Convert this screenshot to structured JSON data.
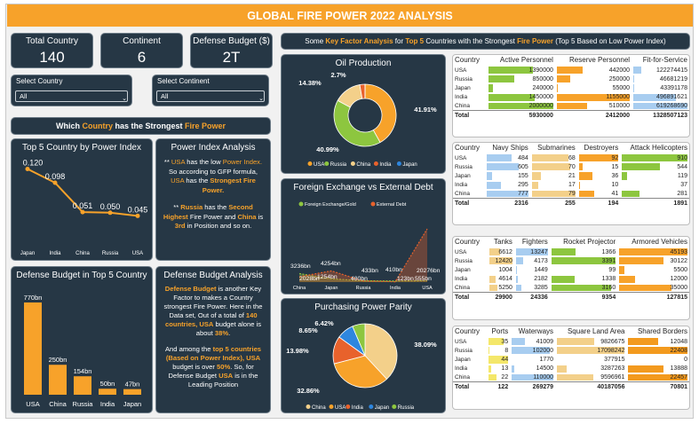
{
  "title": "GLOBAL FIRE POWER 2022 ANALYSIS",
  "kpis": [
    {
      "label": "Total Country",
      "value": "140"
    },
    {
      "label": "Continent",
      "value": "6"
    },
    {
      "label": "Defense Budget ($)",
      "value": "2T"
    }
  ],
  "slicers": {
    "country": {
      "label": "Select Country",
      "value": "All"
    },
    "continent": {
      "label": "Select Continent",
      "value": "All"
    }
  },
  "banner_left": {
    "pre": "Which ",
    "hl": "Country",
    "mid": " has the Strongest ",
    "hl2": "Fire Power"
  },
  "banner_right": {
    "p1": "Some ",
    "h1": "Key Factor Analysis",
    "p2": " for ",
    "h2": "Top 5",
    "p3": " Countries with the Strongest ",
    "h3": "Fire Power",
    "p4": " (Top 5 Based on Low Power Index)"
  },
  "power_index_title": "Top 5 Country by Power Index",
  "power_analysis": {
    "title": "Power Index Analysis",
    "p1a": "** ",
    "p1b": "USA",
    "p1c": " has the low ",
    "p1d": "Power Index.",
    "p1e": " So according to GFP formula, ",
    "p1f": "USA",
    "p1g": " has the ",
    "p1h": "Strongest Fire Power.",
    "p2a": "** ",
    "p2b": "Russia",
    "p2c": " has the ",
    "p2d": "Second Highest",
    "p2e": " Fire Power and ",
    "p2f": "China",
    "p2g": " is ",
    "p2h": "3rd",
    "p2i": " in Position and so on."
  },
  "defense_chart_title": "Defense Budget in Top 5 Country",
  "defense_analysis": {
    "title": "Defense Budget Analysis",
    "p1a": "Defense Budget",
    "p1b": " is another Key Factor to makes a Country strongest Fire Power. Here in the Data set, Out of a total of ",
    "p1c": "140 countries, USA",
    "p1d": " budget alone is about ",
    "p1e": "38%",
    "p1f": ".",
    "p2a": "And among the ",
    "p2b": "top 5 countries (Based on Power Index), USA",
    "p2c": " budget is over ",
    "p2d": "50%",
    "p2e": ". So, for Defense Budget ",
    "p2f": "USA",
    "p2g": " is in the Leading Position"
  },
  "oil_title": "Oil Production",
  "fx_title": "Foreign Exchange vs External Debt",
  "ppp_title": "Purchasing Power Parity",
  "colors": {
    "orange": "#f7a22a",
    "green": "#8dc63f",
    "beige": "#f3d08a",
    "red": "#e8622c",
    "blue": "#2e86de",
    "lightblue": "#a8cdf0",
    "yellow": "#f4e76a",
    "darkorange": "#f39a1e"
  },
  "chart_data": [
    {
      "type": "line",
      "title": "Top 5 Country by Power Index",
      "categories": [
        "Japan",
        "India",
        "China",
        "Russia",
        "USA"
      ],
      "values": [
        0.12,
        0.098,
        0.051,
        0.05,
        0.045
      ],
      "labels": [
        "0.120",
        "0.098",
        "0.051",
        "0.050",
        "0.045"
      ]
    },
    {
      "type": "bar",
      "title": "Defense Budget in Top 5 Country",
      "categories": [
        "USA",
        "China",
        "Russia",
        "India",
        "Japan"
      ],
      "values": [
        770,
        250,
        154,
        50,
        47
      ],
      "labels": [
        "770bn",
        "250bn",
        "154bn",
        "50bn",
        "47bn"
      ]
    },
    {
      "type": "pie",
      "title": "Oil Production",
      "legend": [
        "USA",
        "Russia",
        "China",
        "India",
        "Japan"
      ],
      "values": [
        41.91,
        40.99,
        14.38,
        2.7,
        0.02
      ],
      "labels": [
        "41.91%",
        "40.99%",
        "14.38%",
        "2.7%",
        ""
      ]
    },
    {
      "type": "line",
      "title": "Foreign Exchange vs External Debt",
      "categories": [
        "China",
        "Japan",
        "Russia",
        "India",
        "USA"
      ],
      "series": [
        {
          "name": "Foreign Exchange/Gold",
          "values": [
            3236,
            1254,
            480,
            410,
            555
          ],
          "labels": [
            "3236bn",
            "1254bn",
            "480bn",
            "410bn",
            "555bn"
          ]
        },
        {
          "name": "External Debt",
          "values": [
            2028,
            4254,
            433,
            123,
            20276
          ],
          "labels": [
            "2028bn",
            "4254bn",
            "433bn",
            "123bn",
            "20276bn"
          ]
        }
      ]
    },
    {
      "type": "pie",
      "title": "Purchasing Power Parity",
      "legend": [
        "China",
        "USA",
        "India",
        "Japan",
        "Russia"
      ],
      "values": [
        38.09,
        32.86,
        13.98,
        8.65,
        6.42
      ],
      "labels": [
        "38.09%",
        "32.86%",
        "13.98%",
        "8.65%",
        "6.42%"
      ]
    }
  ],
  "tables": [
    {
      "columns": [
        "Country",
        "Active Personnel",
        "Reserve Personnel",
        "Fit-for-Service"
      ],
      "rows": [
        [
          "USA",
          "1390000",
          "442000",
          "122274415"
        ],
        [
          "Russia",
          "850000",
          "250000",
          "46681219"
        ],
        [
          "Japan",
          "240000",
          "55000",
          "43391178"
        ],
        [
          "India",
          "1450000",
          "1155000",
          "496891621"
        ],
        [
          "China",
          "2000000",
          "510000",
          "619268690"
        ]
      ],
      "total": [
        "Total",
        "5930000",
        "2412000",
        "1328507123"
      ],
      "bar_colors": [
        "#8dc63f",
        "#f7a22a",
        "#a8cdf0"
      ]
    },
    {
      "columns": [
        "Country",
        "Navy Ships",
        "Submarines",
        "Destroyers",
        "Attack Helicopters"
      ],
      "rows": [
        [
          "USA",
          "484",
          "68",
          "92",
          "910"
        ],
        [
          "Russia",
          "605",
          "70",
          "15",
          "544"
        ],
        [
          "Japan",
          "155",
          "21",
          "36",
          "119"
        ],
        [
          "India",
          "295",
          "17",
          "10",
          "37"
        ],
        [
          "China",
          "777",
          "79",
          "41",
          "281"
        ]
      ],
      "total": [
        "Total",
        "2316",
        "255",
        "194",
        "1891"
      ],
      "bar_colors": [
        "#a8cdf0",
        "#f3d08a",
        "#f7a22a",
        "#8dc63f"
      ]
    },
    {
      "columns": [
        "Country",
        "Tanks",
        "Fighters",
        "Rocket Projector",
        "Armored Vehicles"
      ],
      "rows": [
        [
          "USA",
          "6612",
          "13247",
          "1366",
          "45193"
        ],
        [
          "Russia",
          "12420",
          "4173",
          "3391",
          "30122"
        ],
        [
          "Japan",
          "1004",
          "1449",
          "99",
          "5500"
        ],
        [
          "India",
          "4614",
          "2182",
          "1338",
          "12000"
        ],
        [
          "China",
          "5250",
          "3285",
          "3160",
          "35000"
        ]
      ],
      "total": [
        "Total",
        "29900",
        "24336",
        "9354",
        "127815"
      ],
      "bar_colors": [
        "#f3d08a",
        "#a8cdf0",
        "#8dc63f",
        "#f7a22a"
      ]
    },
    {
      "columns": [
        "Country",
        "Ports",
        "Waterways",
        "Square Land Area",
        "Shared Borders"
      ],
      "rows": [
        [
          "USA",
          "35",
          "41009",
          "9826675",
          "12048"
        ],
        [
          "Russia",
          "8",
          "102000",
          "17098242",
          "22408"
        ],
        [
          "Japan",
          "44",
          "1770",
          "377915",
          "0"
        ],
        [
          "India",
          "13",
          "14500",
          "3287263",
          "13888"
        ],
        [
          "China",
          "22",
          "110000",
          "9596961",
          "22457"
        ]
      ],
      "total": [
        "Total",
        "122",
        "269279",
        "40187056",
        "70801"
      ],
      "bar_colors": [
        "#f4e76a",
        "#a8cdf0",
        "#f3d08a",
        "#f39a1e"
      ]
    }
  ]
}
